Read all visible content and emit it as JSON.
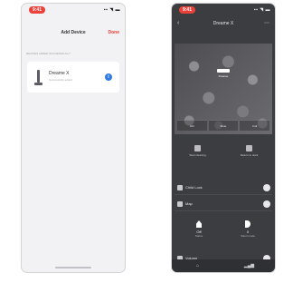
{
  "left": {
    "status_time": "9:41",
    "status_icons": "▪▪ ◥ ▬",
    "nav": {
      "title": "Add Device",
      "done_label": "Done"
    },
    "section_label": "DEVICES ADDED SUCCESSFULLY",
    "device": {
      "name": "Dreame X",
      "subtitle": "Successfully added",
      "info_icon": "i"
    }
  },
  "right": {
    "status_time": "9:41",
    "status_icons": "▪▪ ◥ ▬",
    "nav": {
      "back_icon": "‹",
      "title": "Dreame X",
      "more_icon": "⋯"
    },
    "camera": {
      "overlay_label": "Dreame",
      "buttons": [
        "HD",
        "Mute",
        "Full"
      ]
    },
    "quick_actions": [
      {
        "icon": "fan-icon",
        "label": "Start cleaning"
      },
      {
        "icon": "dock-icon",
        "label": "Return to dock"
      }
    ],
    "rows": [
      {
        "icon": "lock-icon",
        "label": "Child Lock"
      },
      {
        "icon": "map-icon",
        "label": "Map"
      }
    ],
    "controls": [
      {
        "icon": "home-icon",
        "value": "Off",
        "caption": "Status"
      },
      {
        "icon": "moon-icon",
        "value": "0",
        "caption": "Silent mode"
      }
    ],
    "row_bottom": {
      "icon": "light-icon",
      "label": "Volume"
    },
    "tabs": [
      "⌂",
      "▂▄▆"
    ]
  },
  "colors": {
    "accent": "#e8423a",
    "info": "#2f7be0",
    "dark_bg": "#3b3d41"
  }
}
